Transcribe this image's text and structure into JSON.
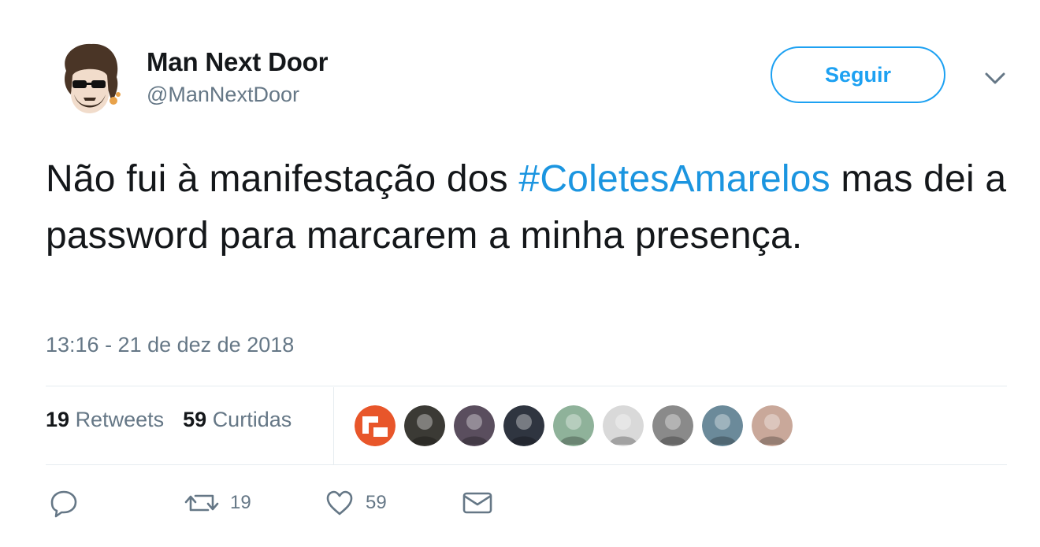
{
  "tweet": {
    "author_name": "Man Next Door",
    "author_handle": "@ManNextDoor",
    "follow_label": "Seguir",
    "text_before": "Não fui à manifestação dos ",
    "hashtag": "#ColetesAmarelos",
    "text_after": " mas dei a password para marcarem a minha presença.",
    "timestamp": "13:16 - 21 de dez de 2018"
  },
  "stats": {
    "retweets_count": "19",
    "retweets_label": "Retweets",
    "likes_count": "59",
    "likes_label": "Curtidas"
  },
  "likers": [
    {
      "name": "liker-avatar-1",
      "color": "#e8562a"
    },
    {
      "name": "liker-avatar-2",
      "color": "#3b3a35"
    },
    {
      "name": "liker-avatar-3",
      "color": "#5a4e5e"
    },
    {
      "name": "liker-avatar-4",
      "color": "#2f3540"
    },
    {
      "name": "liker-avatar-5",
      "color": "#8fb29a"
    },
    {
      "name": "liker-avatar-6",
      "color": "#d9d9d9"
    },
    {
      "name": "liker-avatar-7",
      "color": "#8a8a8a"
    },
    {
      "name": "liker-avatar-8",
      "color": "#6b8a9a"
    },
    {
      "name": "liker-avatar-9",
      "color": "#c9a89a"
    }
  ],
  "actions": {
    "reply_icon": "reply-icon",
    "retweet_count": "19",
    "like_count": "59",
    "dm_icon": "envelope-icon"
  },
  "colors": {
    "accent": "#1da1f2",
    "hashtag": "#1b95e0",
    "secondary_text": "#657786",
    "divider": "#e6ecf0"
  }
}
